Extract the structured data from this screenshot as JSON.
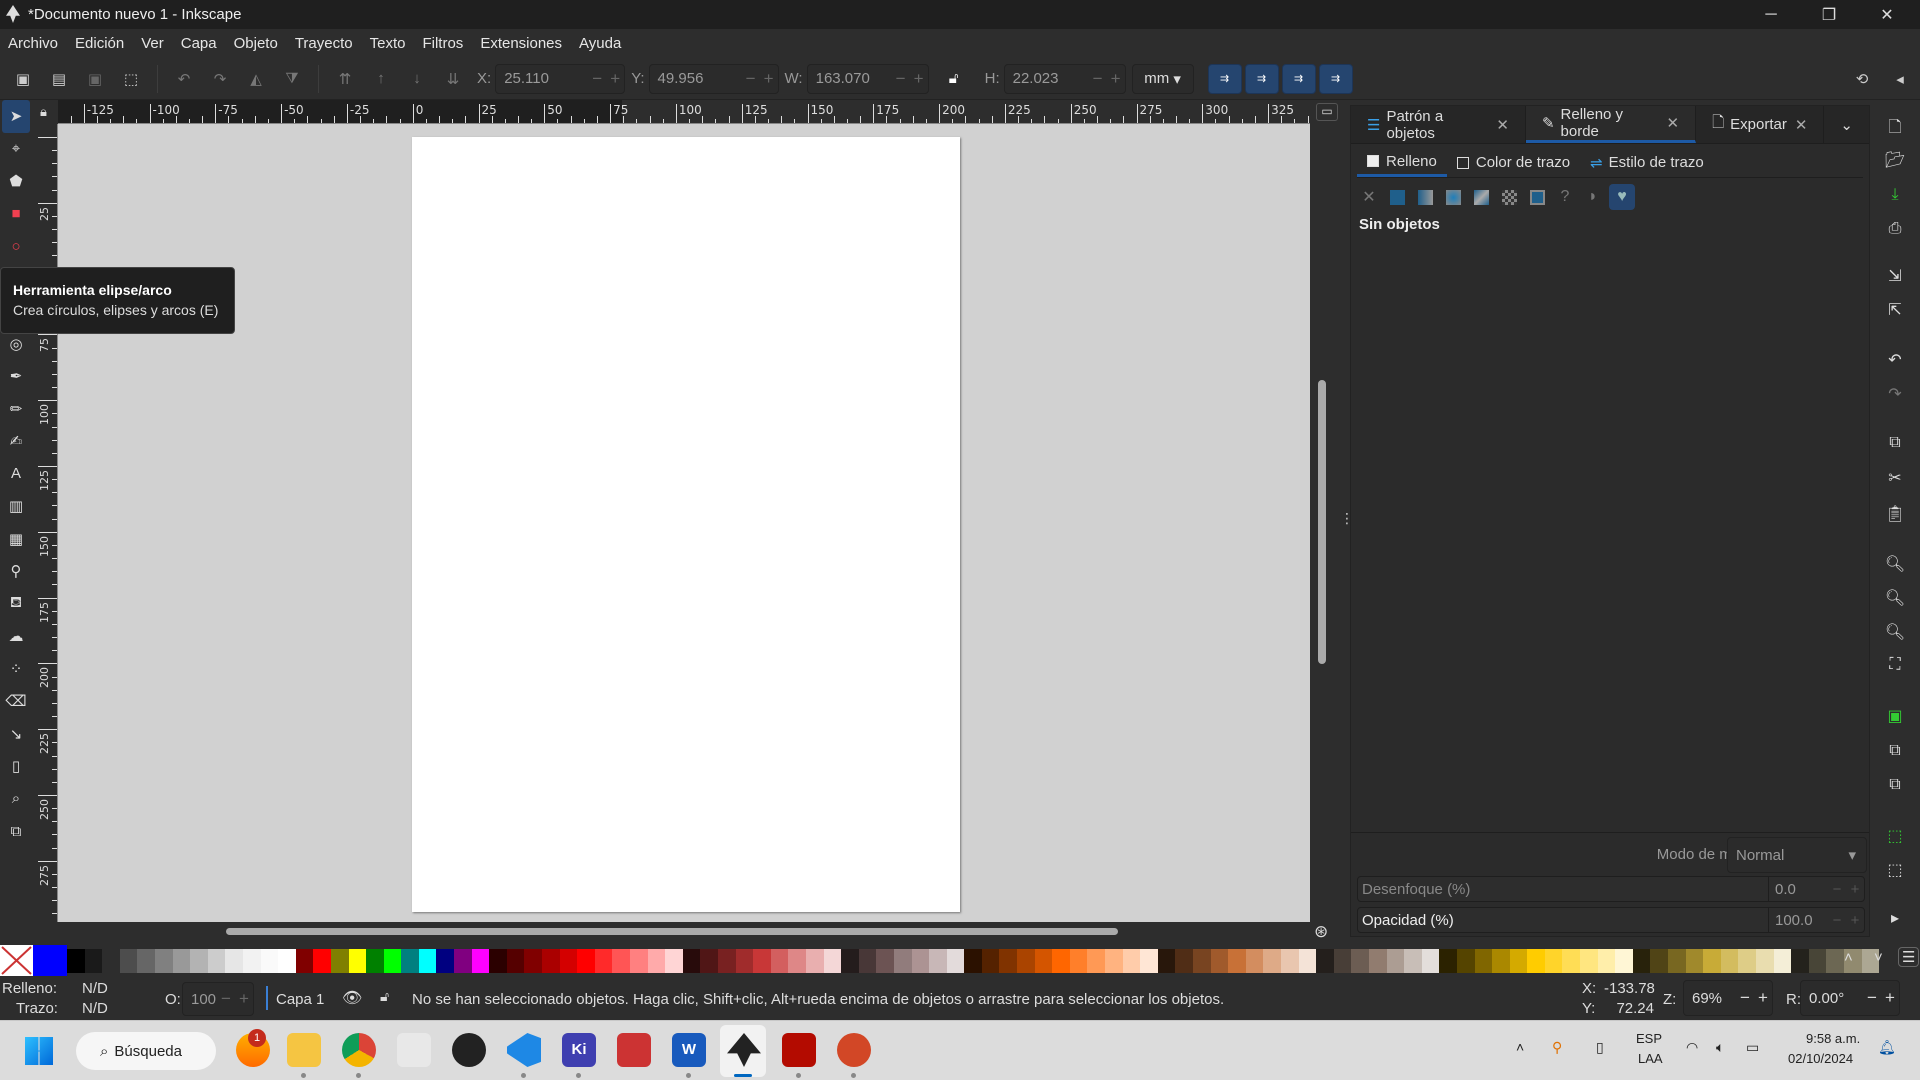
{
  "window": {
    "title": "*Documento nuevo 1 - Inkscape",
    "min": "─",
    "max": "❐",
    "close": "✕"
  },
  "menu": [
    "Archivo",
    "Edición",
    "Ver",
    "Capa",
    "Objeto",
    "Trayecto",
    "Texto",
    "Filtros",
    "Extensiones",
    "Ayuda"
  ],
  "toolbar": {
    "x_label": "X:",
    "x": "25.110",
    "y_label": "Y:",
    "y": "49.956",
    "w_label": "W:",
    "w": "163.070",
    "h_label": "H:",
    "h": "22.023",
    "unit": "mm",
    "minus": "−",
    "plus": "+"
  },
  "rulers": {
    "h_labels": [
      "-125",
      "-100",
      "-75",
      "-50",
      "-25",
      "0",
      "25",
      "50",
      "75",
      "100",
      "125",
      "150",
      "175",
      "200",
      "225",
      "250",
      "275",
      "300",
      "325"
    ],
    "v_labels": [
      "25",
      "50",
      "75",
      "100",
      "125",
      "150",
      "175",
      "200",
      "225",
      "250",
      "275"
    ]
  },
  "tools": [
    "selector",
    "node",
    "shape-builder",
    "rectangle",
    "ellipse",
    "star",
    "3d-box",
    "spiral",
    "pen",
    "pencil",
    "calligraphy",
    "text",
    "gradient",
    "mesh",
    "dropper",
    "paint-bucket",
    "tweak",
    "spray",
    "eraser",
    "connector",
    "pages",
    "zoom",
    "measure"
  ],
  "tooltip": {
    "title": "Herramienta elipse/arco",
    "desc": "Crea círculos, elipses y arcos (E)"
  },
  "panel": {
    "tabs": [
      {
        "label": "Patrón a objetos"
      },
      {
        "label": "Relleno y borde"
      },
      {
        "label": "Exportar"
      }
    ],
    "subtabs": [
      "Relleno",
      "Color de trazo",
      "Estilo de trazo"
    ],
    "no_objects": "Sin objetos",
    "blend_label": "Modo de mezcla:",
    "blend_value": "Normal",
    "blur_label": "Desenfoque (%)",
    "blur_value": "0.0",
    "opacity_label": "Opacidad (%)",
    "opacity_value": "100.0"
  },
  "status": {
    "fill_label": "Relleno:",
    "fill_value": "N/D",
    "stroke_label": "Trazo:",
    "stroke_value": "N/D",
    "o_label": "O:",
    "o_value": "100",
    "layer": "Capa 1",
    "message": "No se han seleccionado objetos. Haga clic, Shift+clic, Alt+rueda encima de objetos o arrastre para seleccionar los objetos.",
    "cx_label": "X:",
    "cx": "-133.78",
    "cy_label": "Y:",
    "cy": "72.24",
    "zoom_label": "Z:",
    "zoom": "69%",
    "rot_label": "R:",
    "rot": "0.00°"
  },
  "taskbar": {
    "search": "Búsqueda",
    "badge": "1",
    "lang1": "ESP",
    "lang2": "LAA",
    "time": "9:58 a.m.",
    "date": "02/10/2024"
  },
  "colors": {
    "accent": "#25456f",
    "canvas": "#d1d1d1",
    "current_fill": "#0000ff"
  },
  "palette": [
    "#000000",
    "#1a1a1a",
    "",
    "#4d4d4d",
    "#666666",
    "#808080",
    "#999999",
    "#b3b3b3",
    "#cccccc",
    "#e6e6e6",
    "#f2f2f2",
    "#fafafa",
    "#ffffff",
    "#800000",
    "#ff0000",
    "#808000",
    "#ffff00",
    "#008000",
    "#00ff00",
    "#008080",
    "#00ffff",
    "#000080",
    "#800080",
    "#ff00ff",
    "#2b0000",
    "#550000",
    "#800000",
    "#aa0000",
    "#d40000",
    "#ff0000",
    "#ff2a2a",
    "#ff5555",
    "#ff8080",
    "#ffaaaa",
    "#ffd5d5",
    "#280b0b",
    "#501616",
    "#782121",
    "#a02c2c",
    "#c83737",
    "#d35f5f",
    "#de8787",
    "#e9afaf",
    "#f4d7d7",
    "#241c1c",
    "#483737",
    "#6c5353",
    "#917c7c",
    "#ac9393",
    "#c8b7b7",
    "#e3dbdb",
    "#2b1100",
    "#552200",
    "#803300",
    "#aa4400",
    "#d45500",
    "#ff6600",
    "#ff7f2a",
    "#ff9955",
    "#ffb380",
    "#ffccaa",
    "#ffe6d5",
    "#28170b",
    "#502d16",
    "#784421",
    "#a05a2c",
    "#c87137",
    "#d38d5f",
    "#deaa87",
    "#e9c6af",
    "#f4e3d7",
    "#241f1c",
    "#483e37",
    "#6c5d53",
    "#917c6f",
    "#ac9d93",
    "#c8beb7",
    "#e3dedb",
    "#2b2200",
    "#554400",
    "#806600",
    "#aa8800",
    "#d4aa00",
    "#ffcc00",
    "#ffd42a",
    "#ffdd55",
    "#ffe680",
    "#ffeeaa",
    "#fff6d5",
    "#28220b",
    "#504416",
    "#786721",
    "#a0892c",
    "#c8ab37",
    "#d3bc5f",
    "#decd87",
    "#e9ddaf",
    "#f4eed7",
    "#24221c",
    "#484537",
    "#6c6753",
    "#918a6f",
    "#aca793"
  ]
}
